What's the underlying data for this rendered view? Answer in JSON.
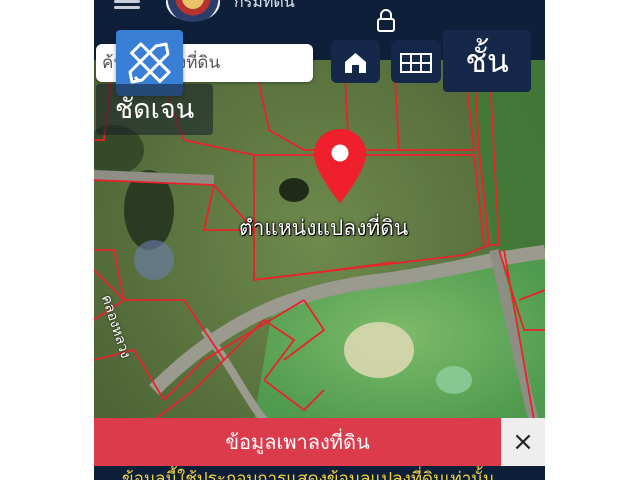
{
  "header": {
    "app_title": "กรมที่ดิน",
    "search_placeholder": "ค้นหาแปลงที่ดิน"
  },
  "toolbar": {
    "layer_label": "ชั้น",
    "clarity_label": "ชัดเจน"
  },
  "map": {
    "pin_label": "ตำแหน่งแปลงที่ดิน",
    "road_label": "คลองหลวง",
    "parcel_line_color": "#e8232b"
  },
  "info_bar": {
    "title": "ข้อมูลเพาลงที่ดิน",
    "close_label": "×",
    "notice": "ข้อมูลนี้ใช้ประกอบการแสดงข้อมูลแปลงที่ดินเท่านั้น"
  },
  "colors": {
    "header_bg": "#0e1f3a",
    "accent_blue": "#3a7fd6",
    "info_red": "#dc3b4b",
    "notice_yellow": "#f3d33b"
  }
}
